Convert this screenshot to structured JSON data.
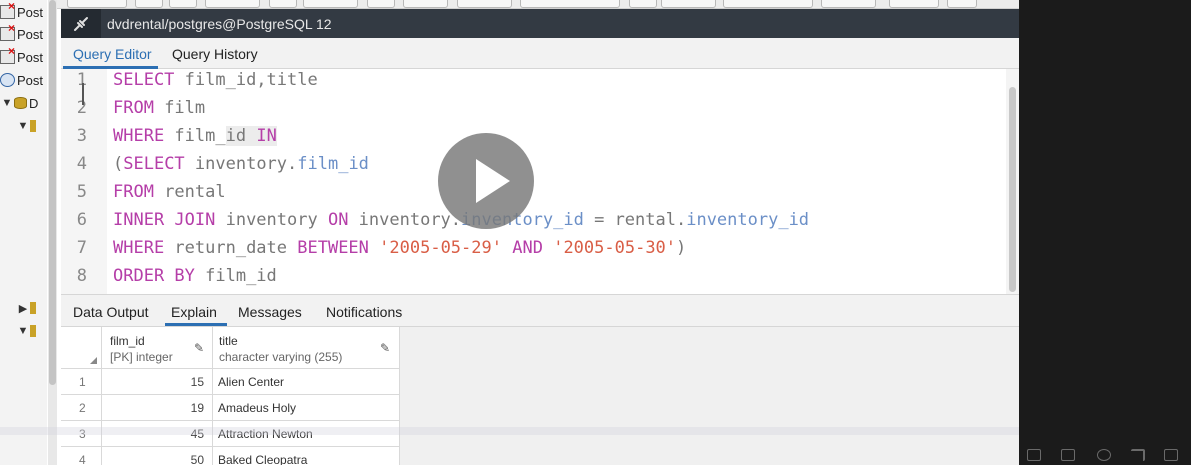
{
  "tree": {
    "items": [
      {
        "label": "Post",
        "icon": "server-disconnected-icon"
      },
      {
        "label": "Post",
        "icon": "server-disconnected-icon"
      },
      {
        "label": "Post",
        "icon": "server-disconnected-icon"
      },
      {
        "label": "Post",
        "icon": "postgres-elephant-icon"
      },
      {
        "label": "D",
        "icon": "database-icon"
      }
    ]
  },
  "title_bar": {
    "title": "dvdrental/postgres@PostgreSQL 12",
    "icon": "disconnect-plug-icon"
  },
  "query_tabs": [
    {
      "label": "Query Editor",
      "active": true
    },
    {
      "label": "Query History",
      "active": false
    }
  ],
  "editor": {
    "line_numbers": [
      "1",
      "2",
      "3",
      "4",
      "5",
      "6",
      "7",
      "8"
    ],
    "lines": [
      [
        {
          "t": "SELECT",
          "c": "kw"
        },
        {
          "t": " film_id,title",
          "c": ""
        }
      ],
      [
        {
          "t": "FROM",
          "c": "kw"
        },
        {
          "t": " film",
          "c": ""
        }
      ],
      [
        {
          "t": "WHERE",
          "c": "kw"
        },
        {
          "t": " film_",
          "c": ""
        },
        {
          "t": "id ",
          "c": "hl"
        },
        {
          "t": "IN",
          "c": "kw hl"
        }
      ],
      [
        {
          "t": "(",
          "c": ""
        },
        {
          "t": "SELECT",
          "c": "kw"
        },
        {
          "t": " inventory.",
          "c": ""
        },
        {
          "t": "film_id",
          "c": "fld"
        }
      ],
      [
        {
          "t": "FROM",
          "c": "kw"
        },
        {
          "t": " rental",
          "c": ""
        }
      ],
      [
        {
          "t": "INNER JOIN",
          "c": "kw"
        },
        {
          "t": " inventory ",
          "c": ""
        },
        {
          "t": "ON",
          "c": "kw"
        },
        {
          "t": " inventory.",
          "c": ""
        },
        {
          "t": "inventory_id",
          "c": "fld"
        },
        {
          "t": " = rental.",
          "c": ""
        },
        {
          "t": "inventory_id",
          "c": "fld"
        }
      ],
      [
        {
          "t": "WHERE",
          "c": "kw"
        },
        {
          "t": " return_date ",
          "c": ""
        },
        {
          "t": "BETWEEN",
          "c": "kw"
        },
        {
          "t": " ",
          "c": ""
        },
        {
          "t": "'2005-05-29'",
          "c": "str"
        },
        {
          "t": " ",
          "c": ""
        },
        {
          "t": "AND",
          "c": "kw"
        },
        {
          "t": " ",
          "c": ""
        },
        {
          "t": "'2005-05-30'",
          "c": "str"
        },
        {
          "t": ")",
          "c": ""
        }
      ],
      [
        {
          "t": "ORDER BY",
          "c": "kw"
        },
        {
          "t": " film_id",
          "c": ""
        }
      ]
    ]
  },
  "output_tabs": [
    {
      "label": "Data Output",
      "active": false
    },
    {
      "label": "Explain",
      "active": true
    },
    {
      "label": "Messages",
      "active": false
    },
    {
      "label": "Notifications",
      "active": false
    }
  ],
  "grid": {
    "columns": [
      {
        "name": "film_id",
        "type": "[PK] integer"
      },
      {
        "name": "title",
        "type": "character varying (255)"
      }
    ],
    "rows": [
      {
        "n": "1",
        "film_id": "15",
        "title": "Alien Center"
      },
      {
        "n": "2",
        "film_id": "19",
        "title": "Amadeus Holy"
      },
      {
        "n": "3",
        "film_id": "45",
        "title": "Attraction Newton"
      },
      {
        "n": "4",
        "film_id": "50",
        "title": "Baked Cleopatra"
      }
    ]
  },
  "colors": {
    "keyword": "#b53ea8",
    "field": "#6b8fc7",
    "string": "#d95e46",
    "accent": "#2c6fb3",
    "title_bar": "#333a43"
  }
}
